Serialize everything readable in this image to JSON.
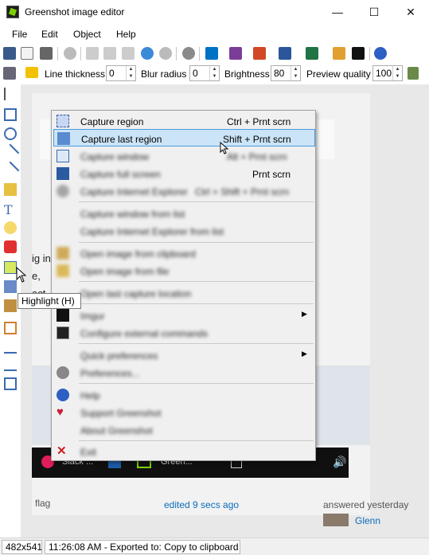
{
  "window": {
    "title": "Greenshot image editor",
    "minimize": "—",
    "maximize": "☐",
    "close": "✕"
  },
  "menubar": [
    "File",
    "Edit",
    "Object",
    "Help"
  ],
  "toolbar": {
    "line_thickness_label": "Line thickness",
    "line_thickness_value": "0",
    "blur_radius_label": "Blur radius",
    "blur_radius_value": "0",
    "brightness_label": "Brightness",
    "brightness_value": "80",
    "preview_quality_label": "Preview quality",
    "preview_quality_value": "100"
  },
  "context_menu": {
    "items": [
      {
        "label": "Capture region",
        "shortcut": "Ctrl + Prnt scrn",
        "icon": "region-icon"
      },
      {
        "label": "Capture last region",
        "shortcut": "Shift + Prnt scrn",
        "icon": "last-region-icon"
      },
      {
        "label": "Capture window",
        "shortcut": "Alt + Prnt scrn",
        "icon": "window-icon"
      },
      {
        "label": "Capture full screen",
        "shortcut": "Prnt scrn",
        "icon": "fullscreen-icon"
      },
      {
        "label": "Capture Internet Explorer",
        "shortcut": "Ctrl + Shift + Prnt scrn",
        "icon": "ie-icon"
      },
      {
        "label": "Capture window from list",
        "shortcut": "",
        "icon": ""
      },
      {
        "label": "Capture Internet Explorer from list",
        "shortcut": "",
        "icon": ""
      },
      {
        "label": "Open image from clipboard",
        "shortcut": "",
        "icon": "clipboard-icon"
      },
      {
        "label": "Open image from file",
        "shortcut": "",
        "icon": "open-file-icon"
      },
      {
        "label": "Open last capture location",
        "shortcut": "",
        "icon": ""
      },
      {
        "label": "Imgur",
        "shortcut": "",
        "icon": "imgur-icon"
      },
      {
        "label": "Configure external commands",
        "shortcut": "",
        "icon": "command-icon"
      },
      {
        "label": "Quick preferences",
        "shortcut": "",
        "icon": ""
      },
      {
        "label": "Preferences...",
        "shortcut": "",
        "icon": "gear-icon"
      },
      {
        "label": "Help",
        "shortcut": "",
        "icon": "help-icon"
      },
      {
        "label": "Support Greenshot",
        "shortcut": "",
        "icon": "heart-icon"
      },
      {
        "label": "About Greenshot",
        "shortcut": "",
        "icon": ""
      },
      {
        "label": "Exit",
        "shortcut": "",
        "icon": "exit-icon"
      }
    ]
  },
  "tooltip": "Highlight (H)",
  "background": {
    "partial_lines": [
      "ig in",
      "e,",
      "act"
    ],
    "flag": "flag",
    "edited": "edited 9 secs ago",
    "answered": "answered yesterday",
    "user": "Glenn",
    "taskbar_slack": "Slack ...",
    "taskbar_green": "Green..."
  },
  "status": {
    "dimensions": "482x541",
    "message": "11:26:08 AM - Exported to: Copy to clipboard"
  },
  "colors": {
    "accent": "#0078d7",
    "highlight_bg": "#cce4f7",
    "highlight_border": "#4a9bde"
  }
}
